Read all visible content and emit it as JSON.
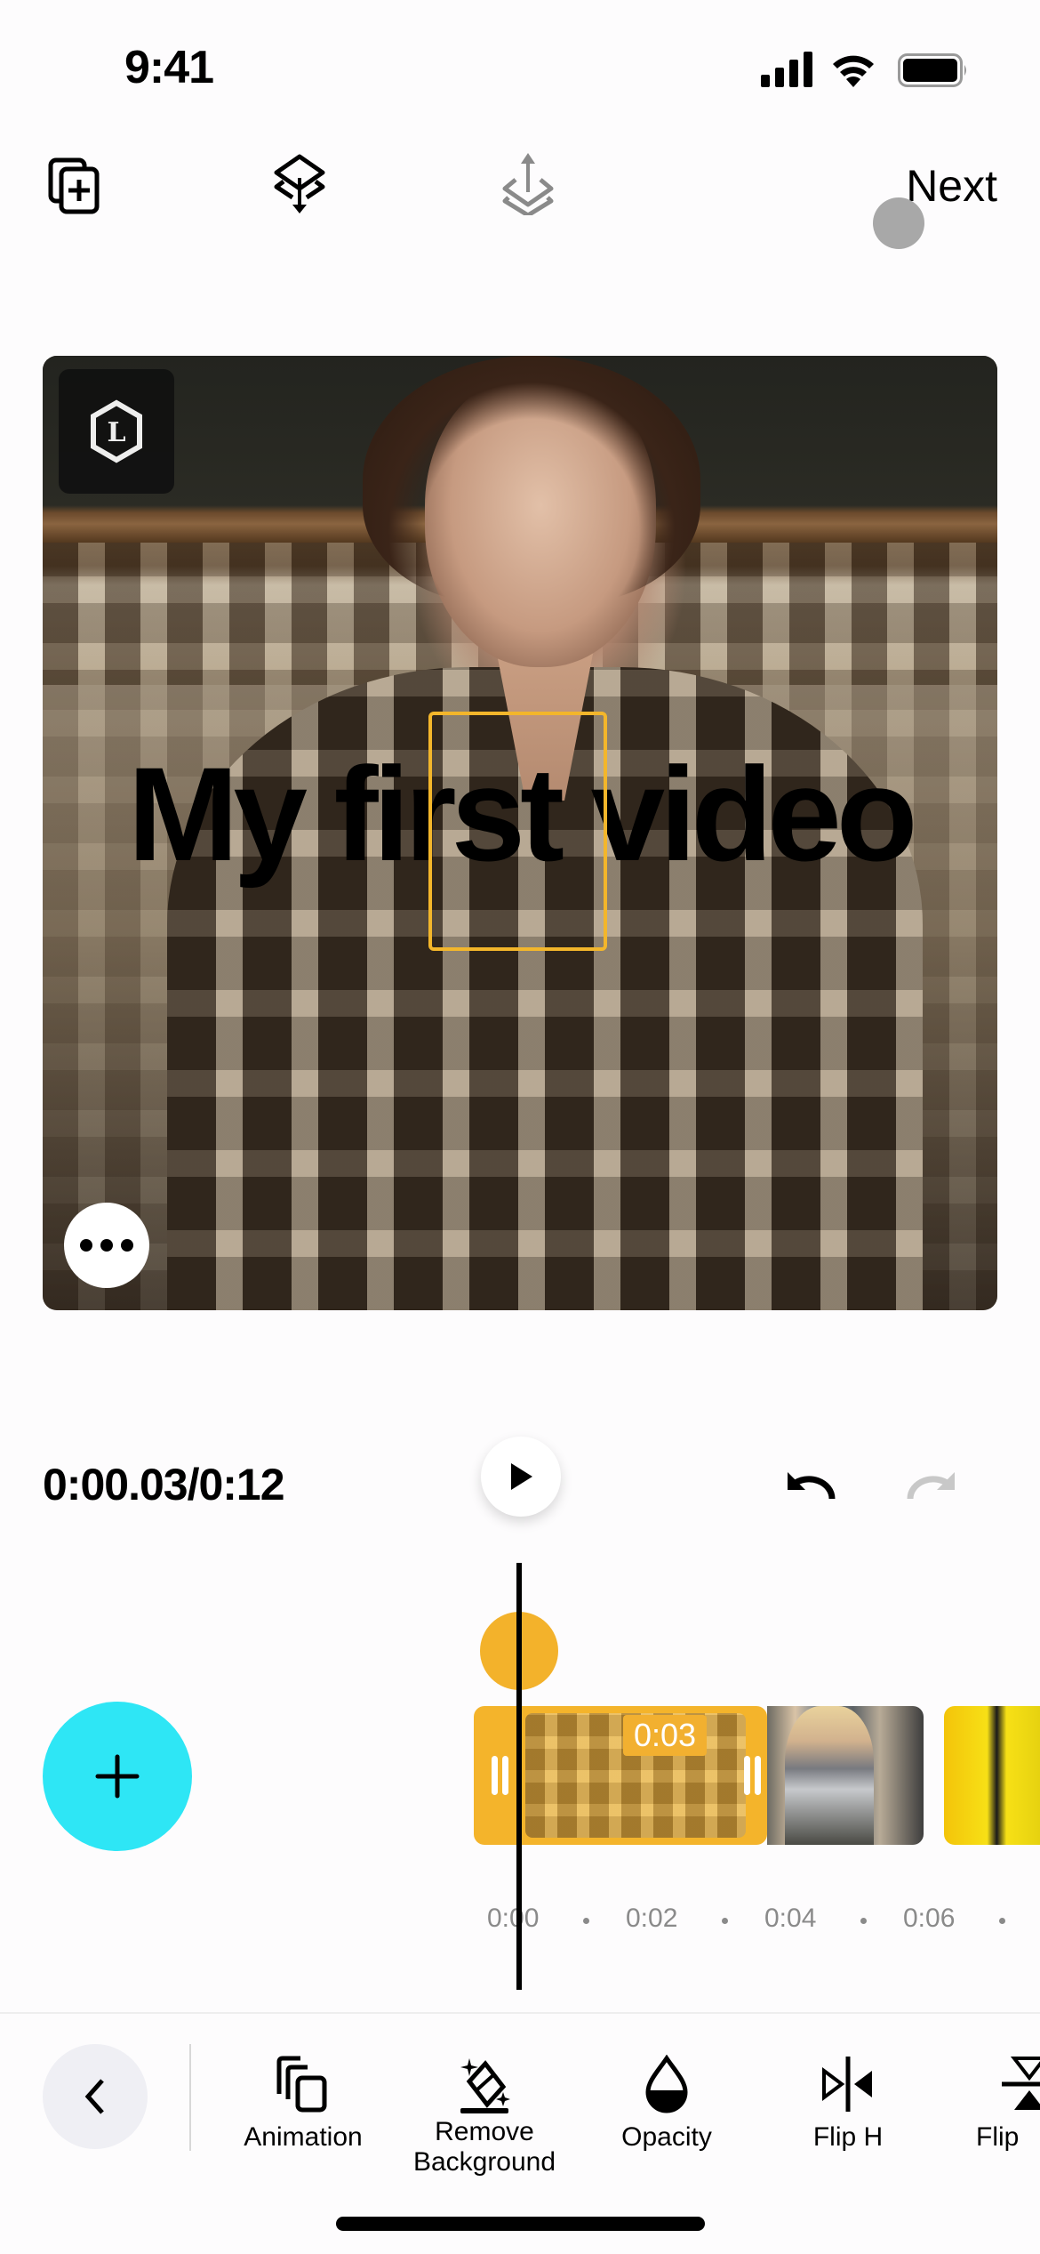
{
  "status_bar": {
    "time": "9:41"
  },
  "top_toolbar": {
    "icons": [
      "add-layer-icon",
      "layer-down-icon",
      "layer-up-icon"
    ],
    "next_label": "Next"
  },
  "canvas": {
    "overlay_text": "My first video",
    "watermark_letter": "L",
    "selection_color": "#f3b62b"
  },
  "playback": {
    "timecode": "0:00.03/0:12",
    "current": "0:00.03",
    "total": "0:12"
  },
  "timeline": {
    "selected_clip_duration": "0:03",
    "ticks": [
      "0:00",
      "0:02",
      "0:04",
      "0:06"
    ],
    "accent_color": "#f4b42b",
    "add_button_color": "#2ee6f5"
  },
  "bottom_toolbar": {
    "tools": [
      {
        "label": "Animation",
        "icon": "animation-icon"
      },
      {
        "label": "Remove\nBackground",
        "icon": "remove-background-icon"
      },
      {
        "label": "Opacity",
        "icon": "opacity-icon"
      },
      {
        "label": "Flip H",
        "icon": "flip-horizontal-icon"
      },
      {
        "label": "Flip",
        "icon": "flip-vertical-icon"
      }
    ]
  }
}
